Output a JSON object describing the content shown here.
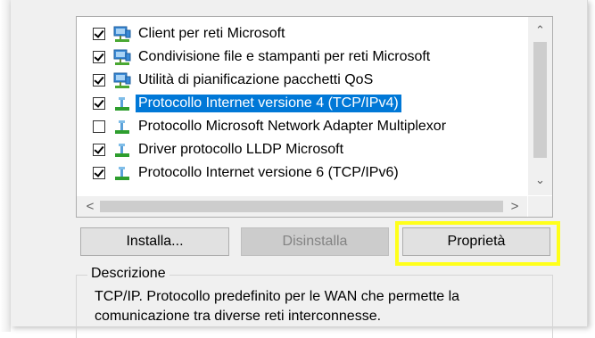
{
  "components": {
    "items": [
      {
        "label": "Client per reti Microsoft",
        "checked": true,
        "icon": "network-client-icon",
        "selected": false
      },
      {
        "label": "Condivisione file e stampanti per reti Microsoft",
        "checked": true,
        "icon": "network-client-icon",
        "selected": false
      },
      {
        "label": "Utilità di pianificazione pacchetti QoS",
        "checked": true,
        "icon": "network-client-icon",
        "selected": false
      },
      {
        "label": "Protocollo Internet versione 4 (TCP/IPv4)",
        "checked": true,
        "icon": "protocol-icon",
        "selected": true
      },
      {
        "label": "Protocollo Microsoft Network Adapter Multiplexor",
        "checked": false,
        "icon": "protocol-icon",
        "selected": false
      },
      {
        "label": "Driver protocollo LLDP Microsoft",
        "checked": true,
        "icon": "protocol-icon",
        "selected": false
      },
      {
        "label": "Protocollo Internet versione 6 (TCP/IPv6)",
        "checked": true,
        "icon": "protocol-icon",
        "selected": false
      }
    ]
  },
  "scroll": {
    "up": "⌃",
    "down": "⌄",
    "left": "<",
    "right": ">"
  },
  "buttons": {
    "install": "Installa...",
    "uninstall": "Disinstalla",
    "properties": "Proprietà"
  },
  "description": {
    "title": "Descrizione",
    "line1": "TCP/IP. Protocollo predefinito per le WAN che permette la",
    "line2": "comunicazione tra diverse reti interconnesse."
  },
  "colors": {
    "selection": "#0078d7",
    "highlight_box": "#ffff1a"
  }
}
